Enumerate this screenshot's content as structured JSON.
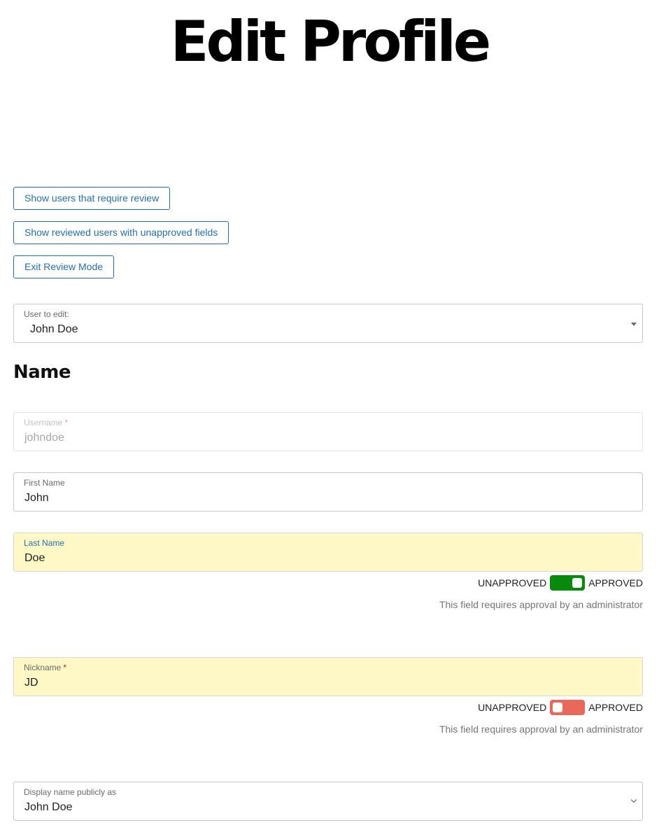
{
  "page": {
    "title": "Edit Profile"
  },
  "review_buttons": {
    "show_require_review": "Show users that require review",
    "show_unapproved_fields": "Show reviewed users with unapproved fields",
    "exit_review": "Exit Review Mode"
  },
  "user_select": {
    "label": "User to edit:",
    "value": "John Doe"
  },
  "section": {
    "name_title": "Name"
  },
  "fields": {
    "username": {
      "label": "Username",
      "required_mark": "*",
      "value": "johndoe",
      "disabled": true
    },
    "first_name": {
      "label": "First Name",
      "value": "John"
    },
    "last_name": {
      "label": "Last Name",
      "value": "Doe",
      "approval": {
        "left_label": "UNAPPROVED",
        "right_label": "APPROVED",
        "approved": true
      },
      "help": "This field requires approval by an administrator"
    },
    "nickname": {
      "label": "Nickname",
      "required_mark": "*",
      "value": "JD",
      "approval": {
        "left_label": "UNAPPROVED",
        "right_label": "APPROVED",
        "approved": false
      },
      "help": "This field requires approval by an administrator"
    },
    "display_name": {
      "label": "Display name publicly as",
      "value": "John Doe"
    }
  },
  "colors": {
    "accent": "#2271b1",
    "approved": "#0a8a0a",
    "unapproved": "#e8685a",
    "pending_field_bg": "#fef8c6"
  }
}
